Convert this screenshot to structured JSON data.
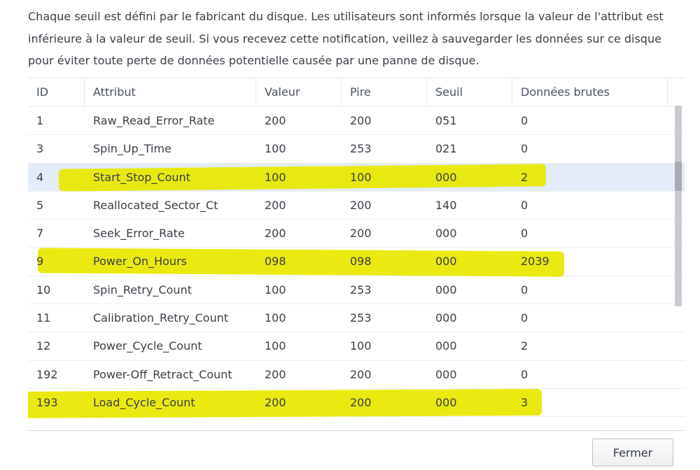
{
  "description": "Chaque seuil est défini par le fabricant du disque. Les utilisateurs sont informés lorsque la valeur de l'attribut est inférieure à la valeur de seuil. Si vous recevez cette notification, veillez à sauvegarder les données sur ce disque pour éviter toute perte de données potentielle causée par une panne de disque.",
  "table": {
    "headers": {
      "id": "ID",
      "attribute": "Attribut",
      "value": "Valeur",
      "worst": "Pire",
      "threshold": "Seuil",
      "raw": "Données brutes"
    },
    "rows": [
      {
        "id": "1",
        "attribute": "Raw_Read_Error_Rate",
        "value": "200",
        "worst": "200",
        "threshold": "051",
        "raw": "0"
      },
      {
        "id": "3",
        "attribute": "Spin_Up_Time",
        "value": "100",
        "worst": "253",
        "threshold": "021",
        "raw": "0"
      },
      {
        "id": "4",
        "attribute": "Start_Stop_Count",
        "value": "100",
        "worst": "100",
        "threshold": "000",
        "raw": "2"
      },
      {
        "id": "5",
        "attribute": "Reallocated_Sector_Ct",
        "value": "200",
        "worst": "200",
        "threshold": "140",
        "raw": "0"
      },
      {
        "id": "7",
        "attribute": "Seek_Error_Rate",
        "value": "200",
        "worst": "200",
        "threshold": "000",
        "raw": "0"
      },
      {
        "id": "9",
        "attribute": "Power_On_Hours",
        "value": "098",
        "worst": "098",
        "threshold": "000",
        "raw": "2039"
      },
      {
        "id": "10",
        "attribute": "Spin_Retry_Count",
        "value": "100",
        "worst": "253",
        "threshold": "000",
        "raw": "0"
      },
      {
        "id": "11",
        "attribute": "Calibration_Retry_Count",
        "value": "100",
        "worst": "253",
        "threshold": "000",
        "raw": "0"
      },
      {
        "id": "12",
        "attribute": "Power_Cycle_Count",
        "value": "100",
        "worst": "100",
        "threshold": "000",
        "raw": "2"
      },
      {
        "id": "192",
        "attribute": "Power-Off_Retract_Count",
        "value": "200",
        "worst": "200",
        "threshold": "000",
        "raw": "0"
      },
      {
        "id": "193",
        "attribute": "Load_Cycle_Count",
        "value": "200",
        "worst": "200",
        "threshold": "000",
        "raw": "3"
      }
    ],
    "selected_row_id": "4",
    "highlighted_row_ids": [
      "4",
      "9",
      "193"
    ]
  },
  "buttons": {
    "close_label": "Fermer"
  },
  "colors": {
    "highlight": "#e8e800",
    "selected_row": "#e3ecf8"
  }
}
